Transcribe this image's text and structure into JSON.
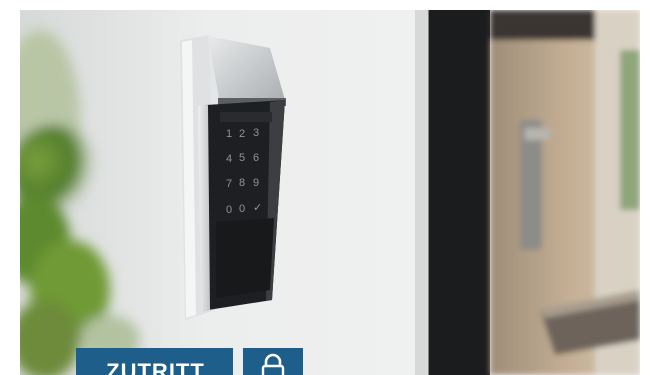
{
  "badge": {
    "label": "ZUTRITT",
    "icon": "lock-icon"
  },
  "keypad": {
    "keys": [
      "1",
      "2",
      "3",
      "4",
      "5",
      "6",
      "7",
      "8",
      "9",
      "0",
      "0",
      "✓"
    ]
  },
  "colors": {
    "badge_background": "#1d5e8b",
    "wall": "#e9eaea",
    "keypad": "#1e1f22",
    "housing": "#c9ccce"
  }
}
